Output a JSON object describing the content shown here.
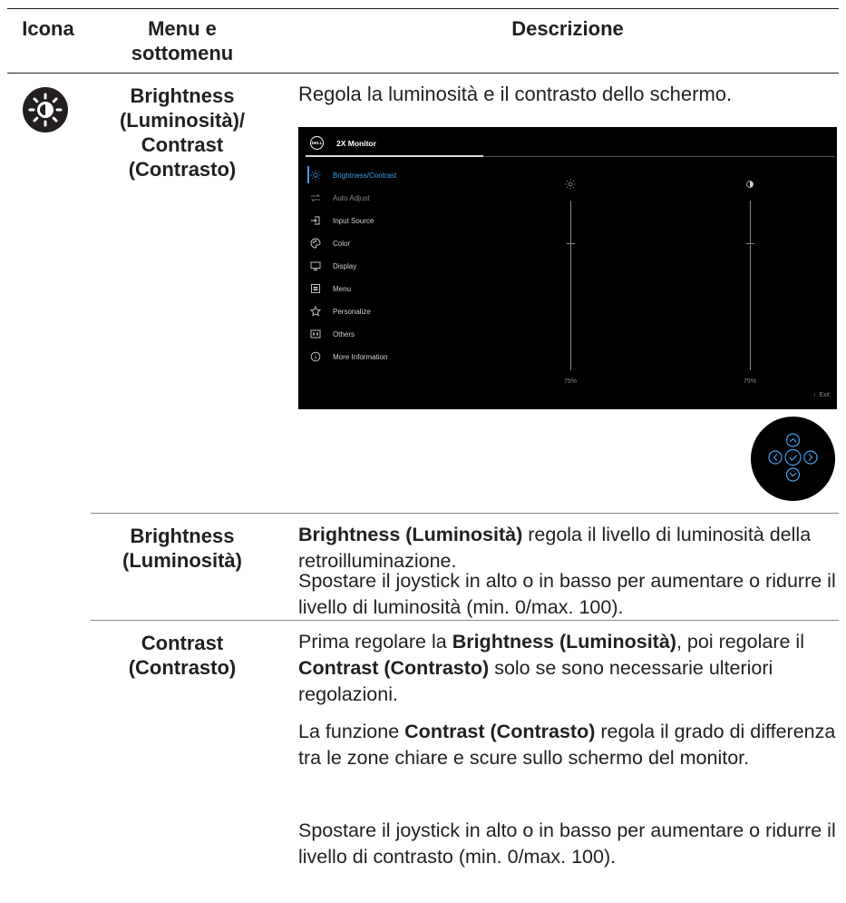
{
  "header": {
    "col1": "Icona",
    "col2": "Menu e\nsottomenu",
    "col3": "Descrizione"
  },
  "row1": {
    "icon": "brightness-sun-icon",
    "menu": "Brightness\n(Luminosità)/\nContrast\n(Contrasto)",
    "desc": "Regola la luminosità e il contrasto dello schermo."
  },
  "osd": {
    "logo": "DELL",
    "title": "2X Monitor",
    "items": [
      {
        "label": "Brightness/Contrast",
        "icon": "sun-icon"
      },
      {
        "label": "Auto Adjust",
        "icon": "auto-adjust-icon"
      },
      {
        "label": "Input Source",
        "icon": "input-source-icon"
      },
      {
        "label": "Color",
        "icon": "color-palette-icon"
      },
      {
        "label": "Display",
        "icon": "display-monitor-icon"
      },
      {
        "label": "Menu",
        "icon": "menu-icon"
      },
      {
        "label": "Personalize",
        "icon": "star-icon"
      },
      {
        "label": "Others",
        "icon": "others-icon"
      },
      {
        "label": "More Information",
        "icon": "info-icon"
      }
    ],
    "brightness_value": "75%",
    "contrast_value": "75%",
    "brightness_level": 0.75,
    "contrast_level": 0.75,
    "exit": "Exit"
  },
  "joystick": {
    "icons": [
      "up-arrow-icon",
      "left-arrow-icon",
      "check-icon",
      "right-arrow-icon",
      "down-arrow-icon"
    ]
  },
  "row2": {
    "menu": "Brightness\n(Luminosità)",
    "p1_bold": "Brightness (Luminosità)",
    "p1_text": " regola il livello di luminosità della retroilluminazione.",
    "p2": "Spostare il joystick in alto o in basso per aumentare o ridurre il livello di luminosità (min. 0/max. 100)."
  },
  "row3": {
    "menu": "Contrast\n(Contrasto)",
    "p1_a": "Prima regolare la ",
    "p1_b": "Brightness (Luminosità)",
    "p1_c": ", poi regolare il ",
    "p1_d": "Contrast (Contrasto)",
    "p1_e": " solo se sono necessarie ulteriori regolazioni.",
    "p2_a": "La funzione ",
    "p2_b": "Contrast (Contrasto)",
    "p2_c": " regola il grado di differenza tra le zone chiare e scure sullo schermo del monitor.",
    "p3": "Spostare il joystick in alto o in basso per aumentare o ridurre il livello di contrasto (min. 0/max. 100)."
  }
}
